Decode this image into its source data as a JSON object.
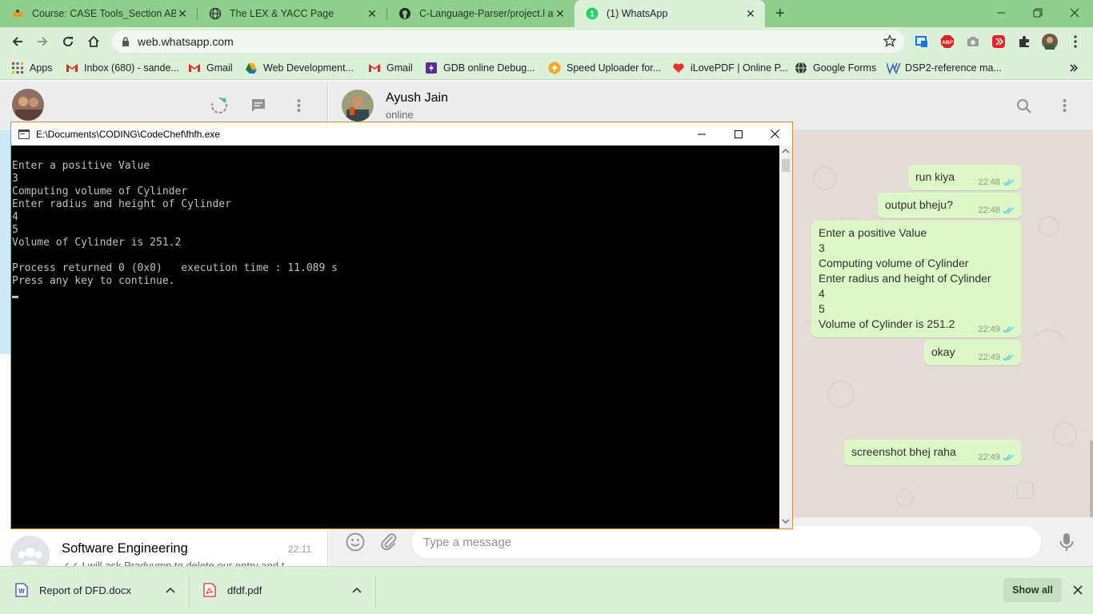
{
  "browser": {
    "tabs": [
      {
        "title": "Course: CASE Tools_Section AB",
        "icon": "moodle-icon"
      },
      {
        "title": "The LEX & YACC Page",
        "icon": "globe-icon"
      },
      {
        "title": "C-Language-Parser/project.l at m",
        "icon": "github-icon"
      },
      {
        "title": "(1) WhatsApp",
        "icon": "whatsapp-icon",
        "active": true
      }
    ],
    "url": "web.whatsapp.com",
    "bookmarks": [
      {
        "label": "Apps",
        "icon": "apps-grid-icon"
      },
      {
        "label": "Inbox (680) - sande...",
        "icon": "gmail-icon"
      },
      {
        "label": "Gmail",
        "icon": "gmail-icon"
      },
      {
        "label": "Web Development...",
        "icon": "google-drive-icon"
      },
      {
        "label": "Gmail",
        "icon": "gmail-icon"
      },
      {
        "label": "GDB online Debug...",
        "icon": "gdb-icon"
      },
      {
        "label": "Speed Uploader for...",
        "icon": "upload-icon"
      },
      {
        "label": "iLovePDF | Online P...",
        "icon": "ilovepdf-icon"
      },
      {
        "label": "Google Forms",
        "icon": "globe-icon"
      },
      {
        "label": "DSP2-reference ma...",
        "icon": "wikipedia-icon"
      }
    ],
    "colors": {
      "frame": "#8fcf8d",
      "toolbar": "#dcefd9"
    }
  },
  "whatsapp": {
    "contact_name": "Ayush Jain",
    "contact_status": "online",
    "messages": [
      {
        "text": "run kiya",
        "time": "22:48"
      },
      {
        "text": "output bheju?",
        "time": "22:48"
      },
      {
        "text": "Enter a positive Value\n3\nComputing volume of Cylinder\nEnter radius and height of Cylinder\n4\n5\nVolume of Cylinder is 251.2",
        "time": "22:49"
      },
      {
        "text": "okay",
        "time": "22:49"
      },
      {
        "text": "screenshot bhej raha",
        "time": "22:49"
      }
    ],
    "input_placeholder": "Type a message",
    "chat_list_item": {
      "name": "Software Engineering",
      "time": "22:11",
      "preview": "✓✓ I will ask Pradyumn to delete our entry and t"
    },
    "colors": {
      "outgoing_bubble": "#dcf8c6",
      "read_ticks": "#4fc3f7",
      "chat_bg": "#e5ddd5"
    }
  },
  "console": {
    "title": "E:\\Documents\\CODING\\CodeChef\\fhfh.exe",
    "lines": [
      "Enter a positive Value",
      "3",
      "Computing volume of Cylinder",
      "Enter radius and height of Cylinder",
      "4",
      "5",
      "Volume of Cylinder is 251.2",
      "",
      "Process returned 0 (0x0)   execution time : 11.089 s",
      "Press any key to continue."
    ]
  },
  "downloads": {
    "items": [
      {
        "name": "Report of DFD.docx",
        "icon": "word-doc-icon"
      },
      {
        "name": "dfdf.pdf",
        "icon": "pdf-icon"
      }
    ],
    "show_all": "Show all"
  }
}
